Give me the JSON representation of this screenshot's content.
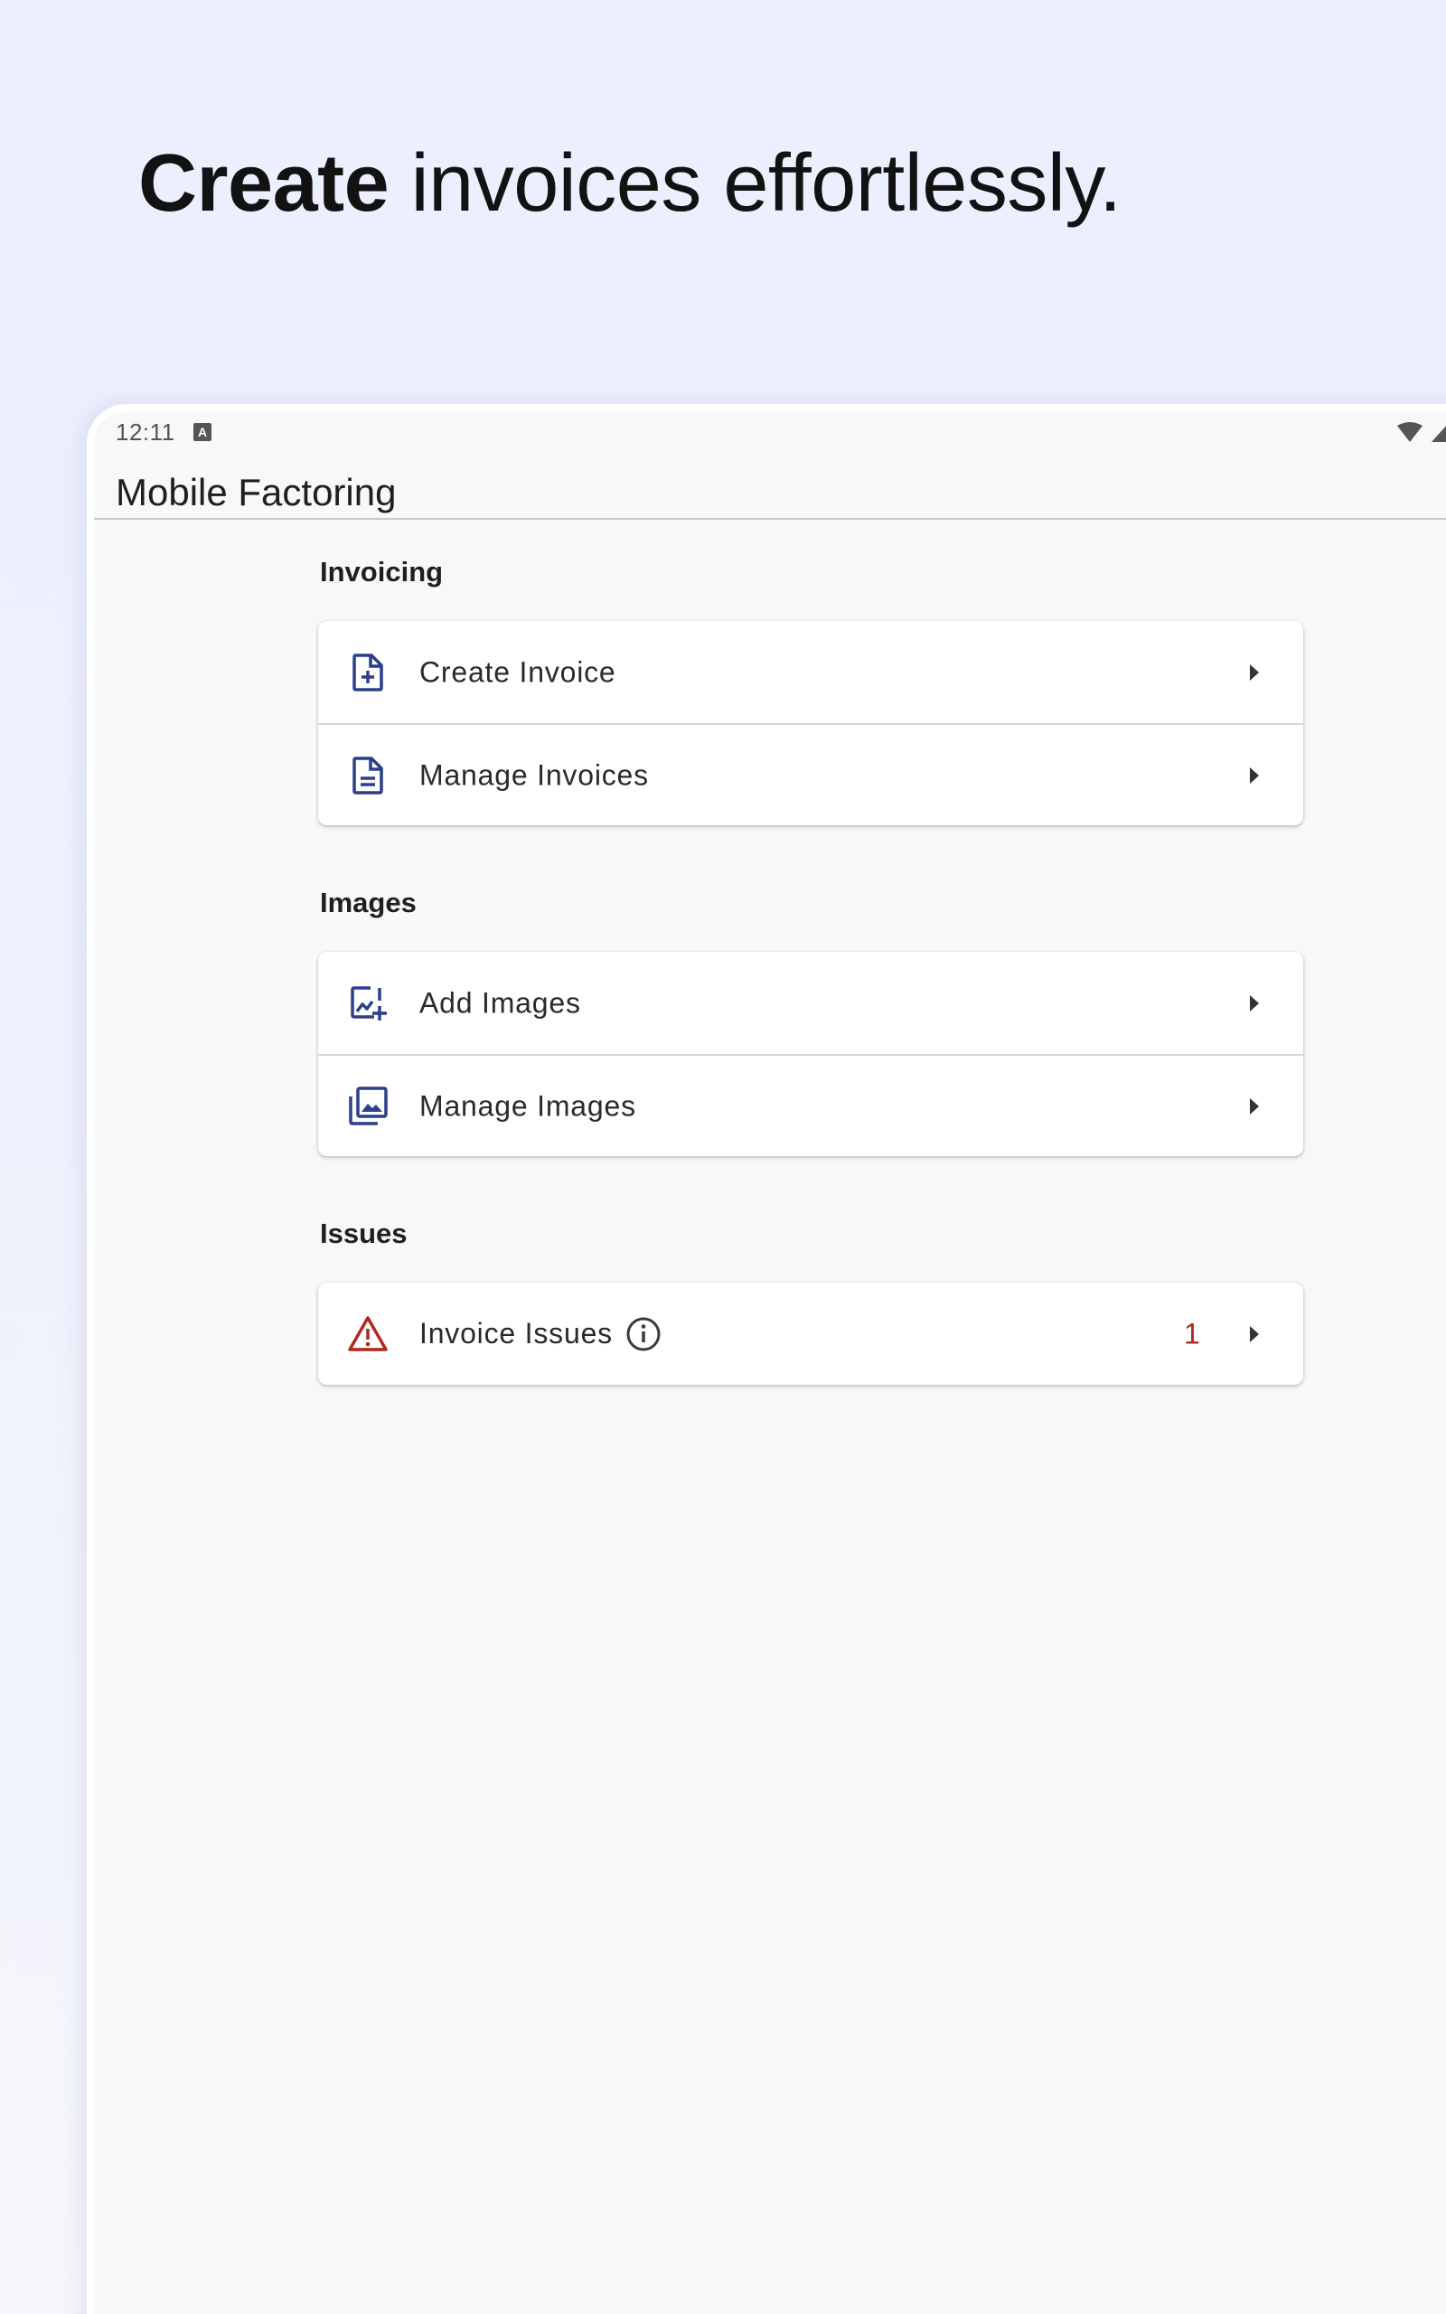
{
  "headline": {
    "bold": "Create",
    "rest": " invoices effortlessly."
  },
  "statusbar": {
    "time": "12:11",
    "notification_badge": "A"
  },
  "appbar": {
    "title": "Mobile Factoring"
  },
  "sections": [
    {
      "title": "Invoicing",
      "items": [
        {
          "label": "Create Invoice",
          "icon": "file-plus-icon"
        },
        {
          "label": "Manage Invoices",
          "icon": "file-lines-icon"
        }
      ]
    },
    {
      "title": "Images",
      "items": [
        {
          "label": "Add Images",
          "icon": "add-image-icon"
        },
        {
          "label": "Manage Images",
          "icon": "image-library-icon"
        }
      ]
    },
    {
      "title": "Issues",
      "items": [
        {
          "label": "Invoice Issues",
          "icon": "warning-icon",
          "count": "1",
          "info_icon": "info-icon"
        }
      ]
    }
  ],
  "colors": {
    "icon_blue": "#2b3f8c",
    "warning_red": "#b3261e",
    "background": "#ebeffe",
    "surface": "#f8f8f8"
  }
}
